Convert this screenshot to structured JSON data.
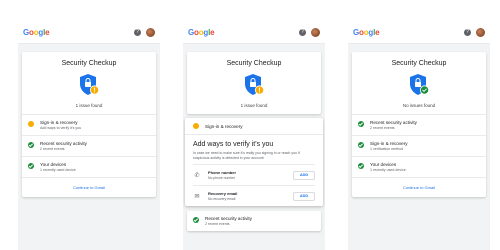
{
  "brand": {
    "letters": [
      "G",
      "o",
      "o",
      "g",
      "l",
      "e"
    ],
    "colors": [
      "#4285f4",
      "#ea4335",
      "#fbbc05",
      "#4285f4",
      "#34a853",
      "#ea4335"
    ]
  },
  "icons": {
    "help": "?",
    "phone": "✆",
    "email": "✉"
  },
  "screens": [
    {
      "title": "Security Checkup",
      "status": "1 issue found",
      "rows": [
        {
          "title": "Sign-in & recovery",
          "sub": "Add ways to verify it's you",
          "state": "warning"
        },
        {
          "title": "Recent security activity",
          "sub": "2 recent events",
          "state": "ok"
        },
        {
          "title": "Your devices",
          "sub": "1 recently used device",
          "state": "ok"
        }
      ],
      "continue": "Continue to Gmail"
    },
    {
      "title": "Security Checkup",
      "status": "1 issue found",
      "section": "Sign-in & recovery",
      "verify_title": "Add ways to verify it's you",
      "verify_desc": "In case we need to make sure it's really you signing in or reach you if suspicious activity is detected in your account",
      "methods": [
        {
          "title": "Phone number",
          "sub": "No phone number",
          "button": "ADD"
        },
        {
          "title": "Recovery email",
          "sub": "No recovery email",
          "button": "ADD"
        }
      ],
      "next_row": {
        "title": "Recent security activity",
        "sub": "2 recent events"
      }
    },
    {
      "title": "Security Checkup",
      "status": "No issues found",
      "rows": [
        {
          "title": "Recent security activity",
          "sub": "2 recent events",
          "state": "ok"
        },
        {
          "title": "Sign-in & recovery",
          "sub": "1 verification method",
          "state": "ok"
        },
        {
          "title": "Your devices",
          "sub": "1 recently used device",
          "state": "ok"
        }
      ],
      "continue": "Continue to Gmail"
    }
  ],
  "colors": {
    "warning": "#f9ab00",
    "ok": "#1e8e3e",
    "shield": "#1a73e8",
    "link": "#1a73e8"
  }
}
